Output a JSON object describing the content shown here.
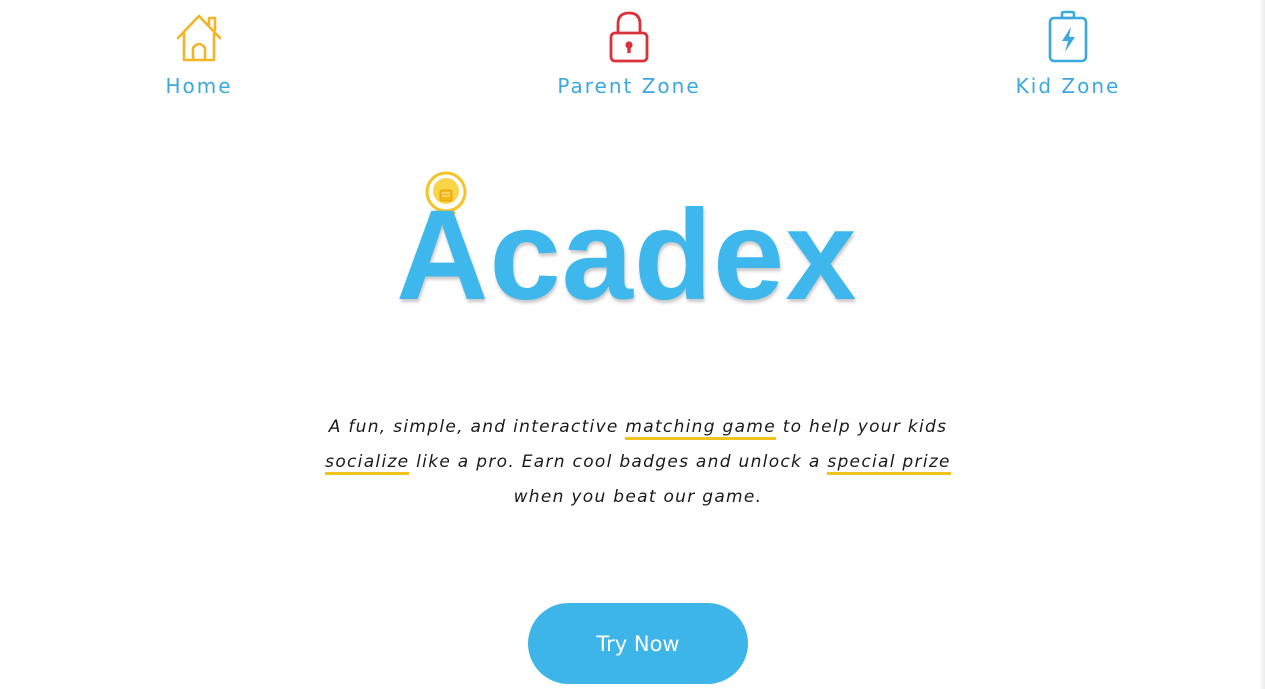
{
  "nav": {
    "items": [
      {
        "label": "Home",
        "icon": "house-icon",
        "icon_color": "#f2b526"
      },
      {
        "label": "Parent Zone",
        "icon": "lock-icon",
        "icon_color": "#d9323a"
      },
      {
        "label": "Kid Zone",
        "icon": "battery-bolt-icon",
        "icon_color": "#3ba8de"
      }
    ],
    "label_color": "#3ba8de"
  },
  "hero": {
    "logo_text": "Acadex",
    "logo_icon": "lightbulb-icon",
    "logo_color": "#3db7ec"
  },
  "tagline": {
    "part1": "A fun, simple, and interactive ",
    "highlight1": "matching game",
    "part2": " to help your kids ",
    "highlight2": "socialize",
    "part3": " like a pro. Earn cool badges and unlock a ",
    "highlight3": "special prize",
    "part4": " when you beat our game.",
    "highlight_color": "#f0c31e"
  },
  "cta": {
    "label": "Try Now",
    "color": "#3db5e8"
  }
}
